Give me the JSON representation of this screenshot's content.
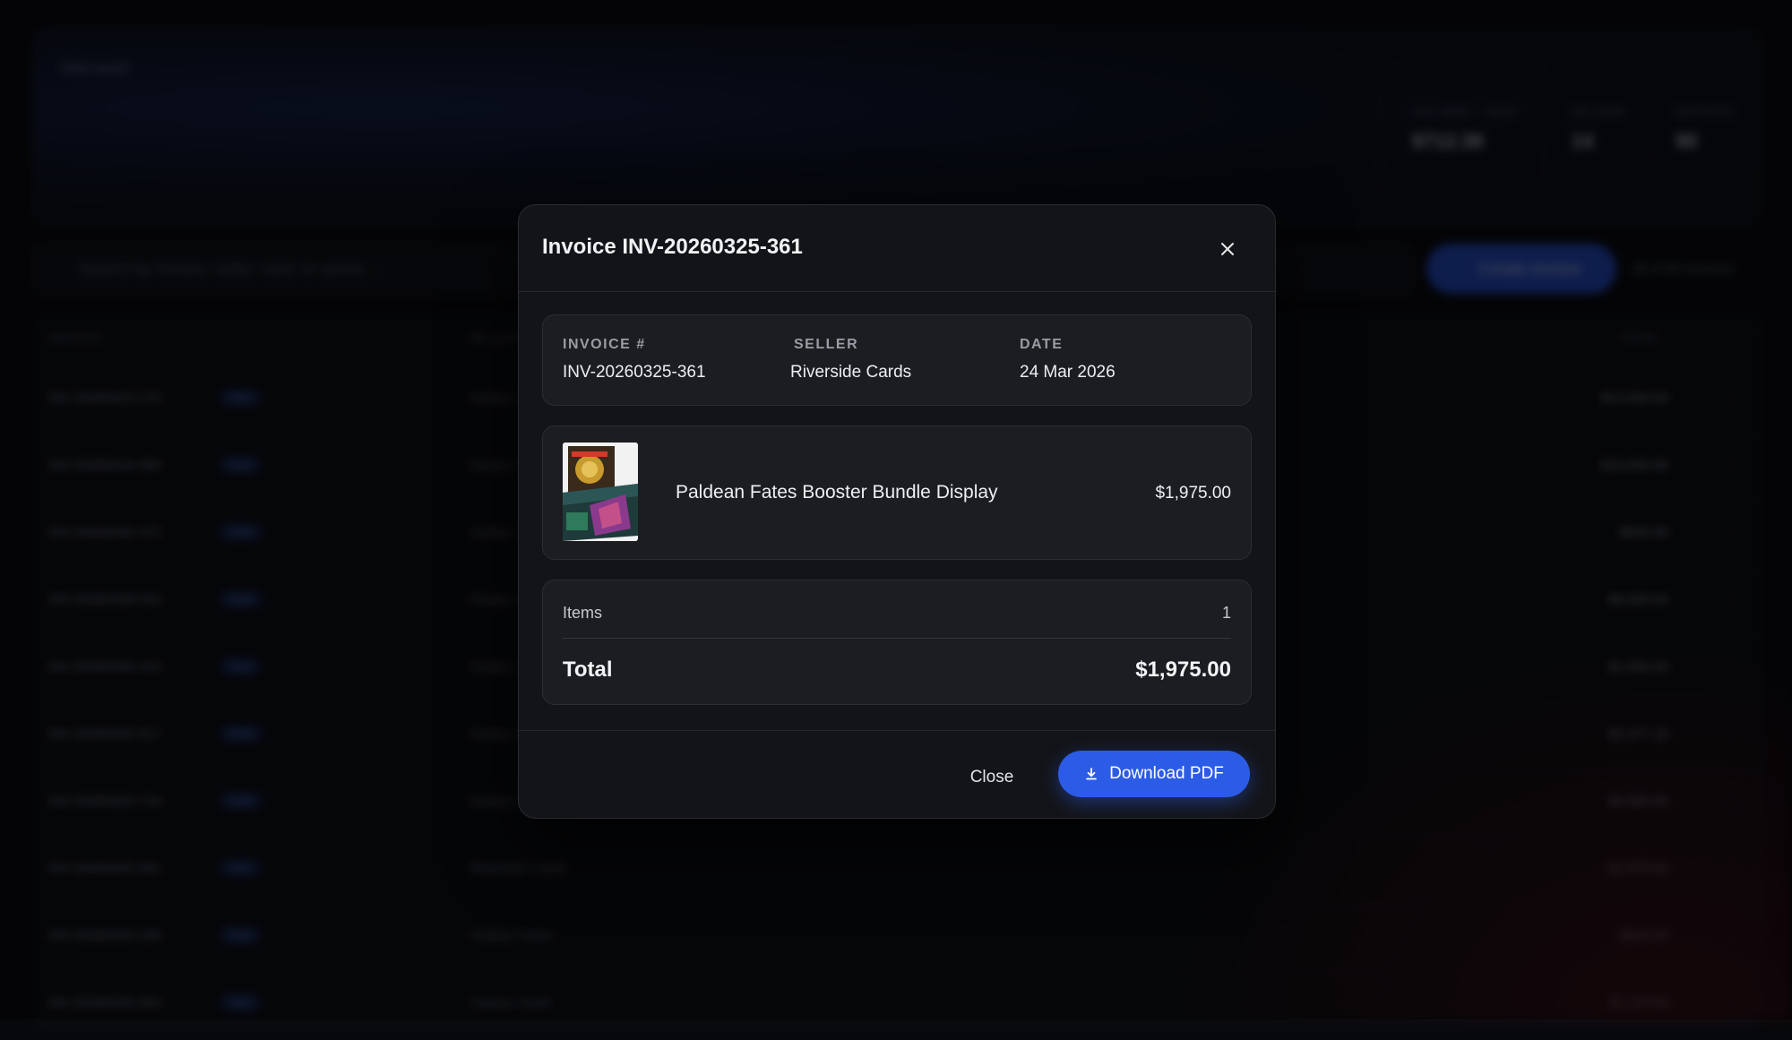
{
  "background": {
    "stats": [
      {
        "label": "AVG DEBT / YEAR",
        "value": "$712.38"
      },
      {
        "label": "SELLERS",
        "value": "14"
      },
      {
        "label": "INVOICES",
        "value": "90"
      }
    ],
    "search_placeholder": "Search by invoice, seller, card, or series...",
    "create_label": "Create invoice",
    "count_label": "90 of 90 invoices",
    "table_headers": {
      "invoice": "INVOICE",
      "seller": "SELLER",
      "total": "TOTAL"
    },
    "rows": [
      {
        "id": "INV-20260423-278",
        "badge": "Paid",
        "seller": "Galaxy Cards",
        "total": "$10,000.00"
      },
      {
        "id": "INV-20260419-486",
        "badge": "Paid",
        "seller": "Galaxy Cards",
        "total": "$10,000.00"
      },
      {
        "id": "INV-20260402-472",
        "badge": "Draft",
        "seller": "Galaxy Cards",
        "total": "$600.00"
      },
      {
        "id": "INV-20260328-533",
        "badge": "Draft",
        "seller": "Galaxy Cards",
        "total": "$6,000.00"
      },
      {
        "id": "INV-20260326-416",
        "badge": "Paid",
        "seller": "Galaxy Cards",
        "total": "$1,000.00"
      },
      {
        "id": "INV-20260325-617",
        "badge": "Draft",
        "seller": "Galaxy Cards",
        "total": "$2,477.16"
      },
      {
        "id": "INV-20260325-718",
        "badge": "Draft",
        "seller": "Galaxy Cards",
        "total": "$3,082.00"
      },
      {
        "id": "INV-20260325-361",
        "badge": "Paid",
        "seller": "Riverside Cards",
        "total": "$1,975.00"
      },
      {
        "id": "INV-20260320-226",
        "badge": "Paid",
        "seller": "Galaxy Cards",
        "total": "$825.00"
      },
      {
        "id": "INV-20260318-303",
        "badge": "Paid",
        "seller": "Galaxy Cards",
        "total": "$1,110.00"
      }
    ]
  },
  "modal": {
    "title": "Invoice INV-20260325-361",
    "meta": {
      "invoice_label": "INVOICE #",
      "invoice_value": "INV-20260325-361",
      "seller_label": "SELLER",
      "seller_value": "Riverside Cards",
      "date_label": "DATE",
      "date_value": "24 Mar 2026"
    },
    "item": {
      "name": "Paldean Fates Booster Bundle Display",
      "price": "$1,975.00"
    },
    "summary": {
      "items_label": "Items",
      "items_value": "1",
      "total_label": "Total",
      "total_value": "$1,975.00"
    },
    "footer": {
      "close_label": "Close",
      "download_label": "Download PDF"
    }
  },
  "icons": {
    "close": "close-icon",
    "download": "download-icon"
  },
  "colors": {
    "accent": "#2c5ce6",
    "modal_bg": "#131417",
    "card_bg": "#1c1d21"
  }
}
